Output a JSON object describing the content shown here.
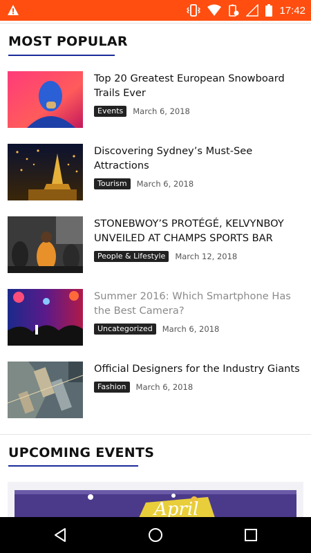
{
  "status_bar": {
    "time": "17:42"
  },
  "most_popular": {
    "heading": "MOST POPULAR",
    "items": [
      {
        "title": "Top 20 Greatest European Snowboard Trails Ever",
        "category": "Events",
        "date": "March 6, 2018"
      },
      {
        "title": "Discovering Sydney’s Must-See Attractions",
        "category": "Tourism",
        "date": "March 6, 2018"
      },
      {
        "title": "STONEBWOY’S PROTÉGÉ, KELVYNBOY UNVEILED AT CHAMPS SPORTS BAR",
        "category": "People & Lifestyle",
        "date": "March 12, 2018"
      },
      {
        "title": "Summer 2016: Which Smartphone Has the Best Camera?",
        "category": "Uncategorized",
        "date": "March 6, 2018"
      },
      {
        "title": "Official Designers for the Industry Giants",
        "category": "Fashion",
        "date": "March 6, 2018"
      }
    ]
  },
  "upcoming_events": {
    "heading": "UPCOMING EVENTS",
    "banner_text": "April"
  },
  "colors": {
    "status_bar": "#ff4e0f",
    "accent_underline": "#1a2a9a",
    "tag_bg": "#222222"
  }
}
